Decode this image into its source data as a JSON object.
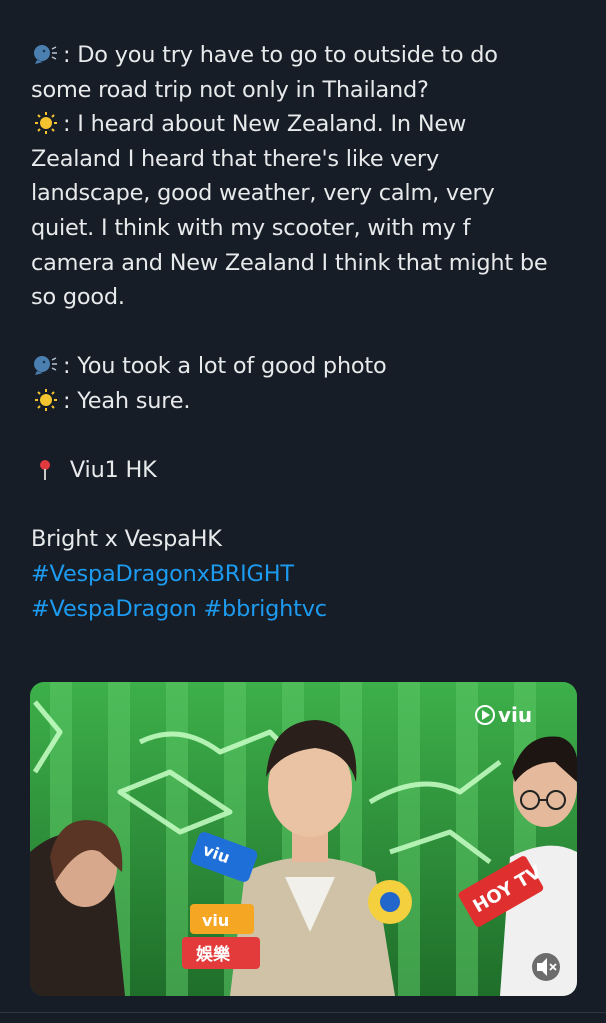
{
  "tweet": {
    "lines": [
      {
        "emoji": "speaking-head",
        "text": ": Do you try have to go to outside to do"
      },
      {
        "text": "some road trip not only in Thailand?"
      },
      {
        "emoji": "sun",
        "text": ": I heard about New Zealand. In New"
      },
      {
        "text": "Zealand I heard that there's like very"
      },
      {
        "text": "landscape, good weather, very calm, very"
      },
      {
        "text": "quiet. I think with my scooter, with my f"
      },
      {
        "text": "camera and New Zealand I think that might be"
      },
      {
        "text": "so good."
      },
      {
        "blank": true
      },
      {
        "emoji": "speaking-head",
        "text": ": You took a lot of good photo"
      },
      {
        "emoji": "sun",
        "text": ": Yeah sure."
      },
      {
        "blank": true
      },
      {
        "emoji": "pin",
        "text": " Viu1 HK"
      },
      {
        "blank": true
      },
      {
        "text": "Bright x VespaHK"
      }
    ],
    "hashtags_line1": "#VespaDragonxBRIGHT",
    "hashtags_line2": "#VespaDragon #bbrightvc"
  },
  "media": {
    "watermark": "viu",
    "mic_labels": [
      "viu",
      "viu",
      "娛樂",
      "HOY TV"
    ],
    "colors": {
      "background_green": "#2e9a3c",
      "neon": "#9dffa0",
      "hashtag_blue": "#1d9bf0"
    },
    "mute_icon": "speaker-muted-icon"
  }
}
